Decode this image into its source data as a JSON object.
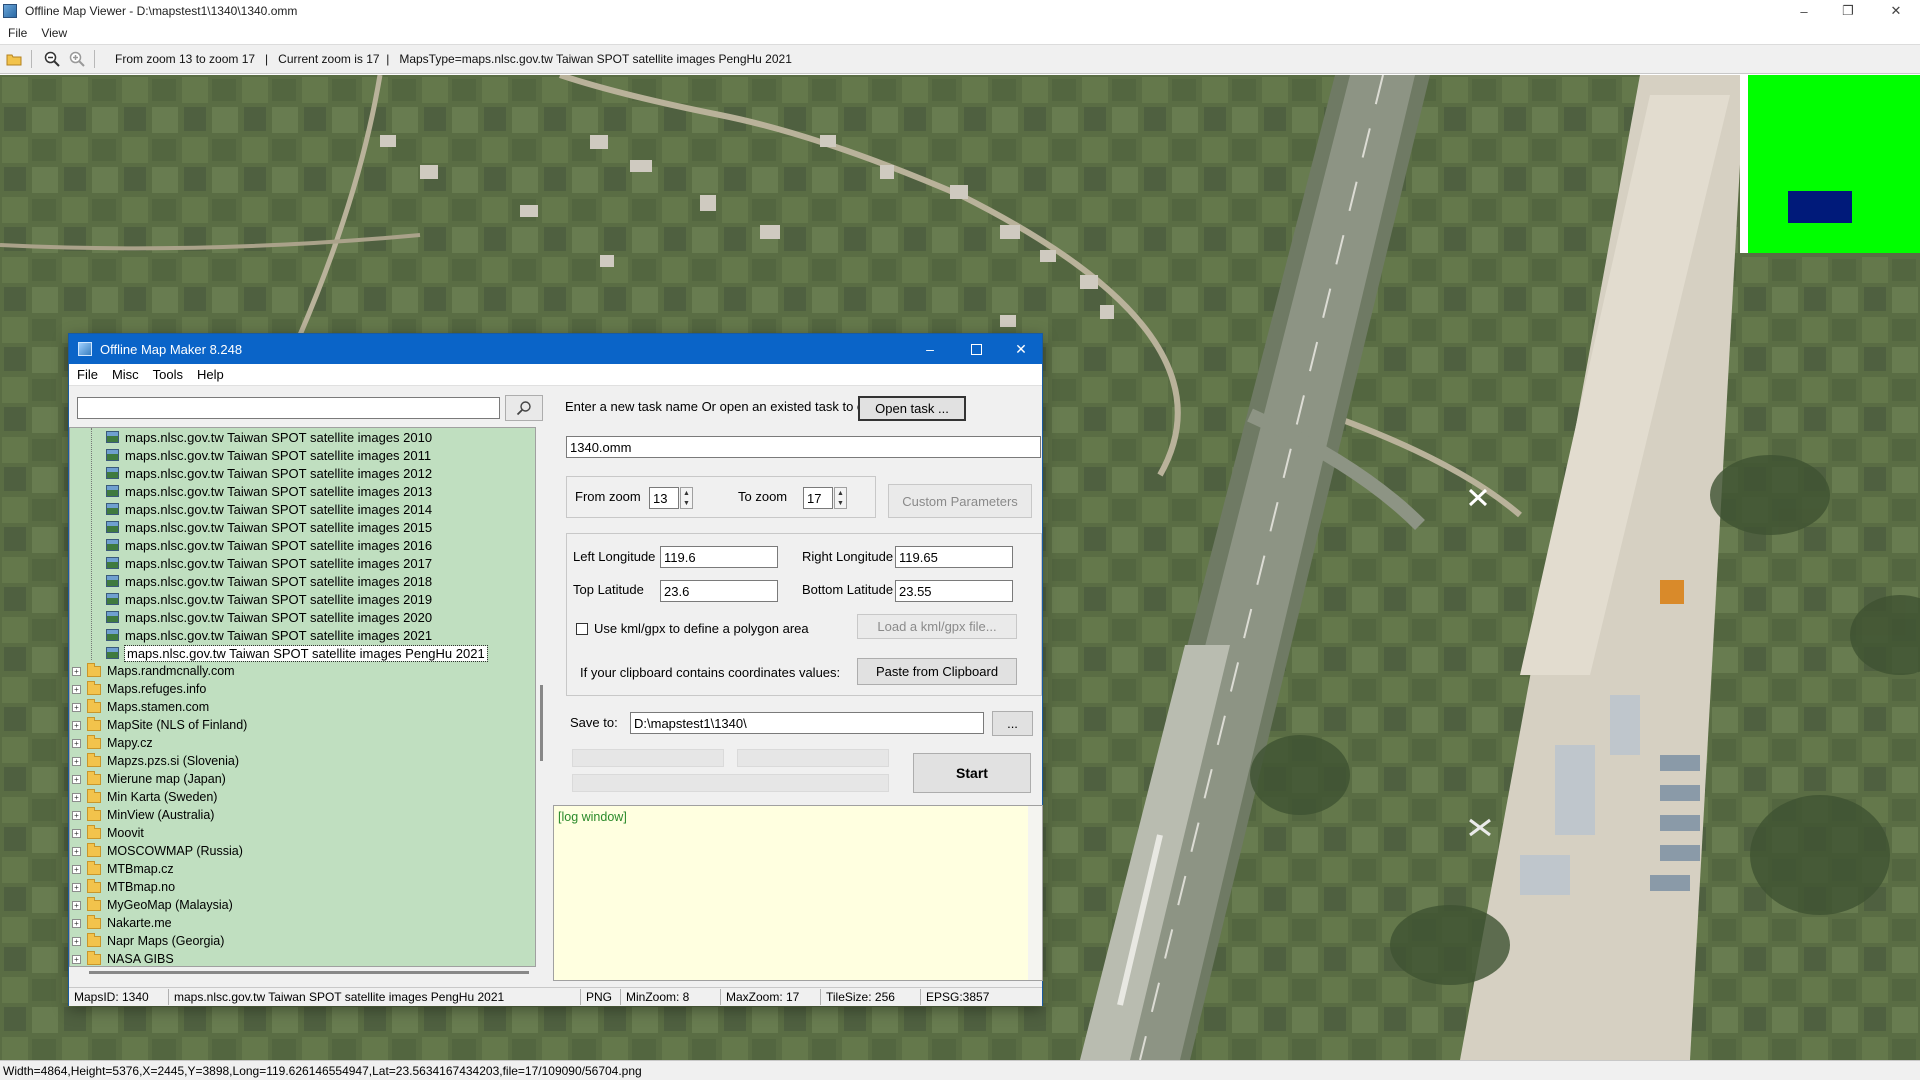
{
  "window": {
    "title": "Offline Map Viewer - D:\\mapstest1\\1340\\1340.omm",
    "controls": {
      "minimize": "–",
      "maximize": "❐",
      "close": "✕"
    }
  },
  "menu": {
    "file": "File",
    "view": "View"
  },
  "toolbar": {
    "status_text": "From zoom 13 to zoom 17   |   Current zoom is 17  |   MapsType=maps.nlsc.gov.tw Taiwan SPOT satellite images PengHu 2021"
  },
  "statusbar": {
    "text": "Width=4864,Height=5376,X=2445,Y=3898,Long=119.626146554947,Lat=23.5634167434203,file=17/109090/56704.png"
  },
  "minimap": {
    "background_color": "#00ff00",
    "viewport_color": "#001a7a"
  },
  "dialog": {
    "title": "Offline Map Maker 8.248",
    "menu": [
      "File",
      "Misc",
      "Tools",
      "Help"
    ],
    "search": {
      "value": ""
    },
    "tree": {
      "children": [
        "maps.nlsc.gov.tw Taiwan SPOT satellite images 2010",
        "maps.nlsc.gov.tw Taiwan SPOT satellite images 2011",
        "maps.nlsc.gov.tw Taiwan SPOT satellite images 2012",
        "maps.nlsc.gov.tw Taiwan SPOT satellite images 2013",
        "maps.nlsc.gov.tw Taiwan SPOT satellite images 2014",
        "maps.nlsc.gov.tw Taiwan SPOT satellite images 2015",
        "maps.nlsc.gov.tw Taiwan SPOT satellite images 2016",
        "maps.nlsc.gov.tw Taiwan SPOT satellite images 2017",
        "maps.nlsc.gov.tw Taiwan SPOT satellite images 2018",
        "maps.nlsc.gov.tw Taiwan SPOT satellite images 2019",
        "maps.nlsc.gov.tw Taiwan SPOT satellite images 2020",
        "maps.nlsc.gov.tw Taiwan SPOT satellite images 2021",
        "maps.nlsc.gov.tw Taiwan SPOT satellite images PengHu 2021"
      ],
      "selected_index": 12,
      "folders": [
        "Maps.randmcnally.com",
        "Maps.refuges.info",
        "Maps.stamen.com",
        "MapSite (NLS of Finland)",
        "Mapy.cz",
        "Mapzs.pzs.si (Slovenia)",
        "Mierune map (Japan)",
        "Min Karta (Sweden)",
        "MinView (Australia)",
        "Moovit",
        "MOSCOWMAP (Russia)",
        "MTBmap.cz",
        "MTBmap.no",
        "MyGeoMap (Malaysia)",
        "Nakarte.me",
        "Napr Maps (Georgia)",
        "NASA GIBS"
      ]
    },
    "task": {
      "prompt": "Enter a new task name Or open an existed task to continue:",
      "open_button": "Open task ...",
      "name": "1340.omm"
    },
    "zoom": {
      "from_label": "From zoom",
      "from_value": "13",
      "to_label": "To zoom",
      "to_value": "17",
      "custom_button": "Custom Parameters"
    },
    "coords": {
      "left_lon_label": "Left Longitude",
      "left_lon": "119.6",
      "right_lon_label": "Right Longitude",
      "right_lon": "119.65",
      "top_lat_label": "Top Latitude",
      "top_lat": "23.6",
      "bottom_lat_label": "Bottom Latitude",
      "bottom_lat": "23.55",
      "kml_label": "Use kml/gpx to define a polygon area",
      "kml_checked": false,
      "load_kml_button": "Load a kml/gpx file...",
      "clipboard_label": "If your clipboard contains coordinates values:",
      "paste_button": "Paste from Clipboard"
    },
    "save": {
      "label": "Save to:",
      "path": "D:\\mapstest1\\1340\\",
      "browse_button": "...",
      "start_button": "Start"
    },
    "log": {
      "text": "[log window]"
    },
    "status": {
      "maps_id": "MapsID: 1340",
      "maps_name": "maps.nlsc.gov.tw Taiwan SPOT satellite images PengHu 2021",
      "format": "PNG",
      "min_zoom": "MinZoom: 8",
      "max_zoom": "MaxZoom: 17",
      "tile_size": "TileSize: 256",
      "epsg": "EPSG:3857"
    }
  }
}
